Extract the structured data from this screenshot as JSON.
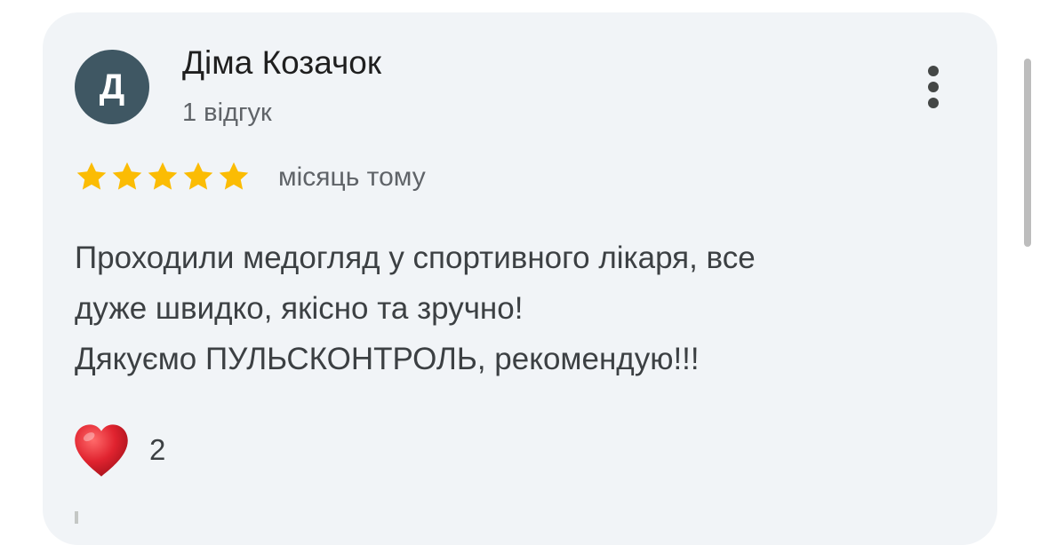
{
  "review": {
    "avatar_letter": "Д",
    "author_name": "Діма Козачок",
    "review_count": "1 відгук",
    "rating": 5,
    "rating_max": 5,
    "time_ago": "місяць тому",
    "text_lines": [
      "Проходили медогляд у спортивного лікаря, все",
      "дуже швидко, якісно та зручно!",
      "Дякуємо ПУЛЬСКОНТРОЛЬ, рекомендую!!!"
    ],
    "reaction_icon": "red-heart-icon",
    "reaction_count": "2"
  },
  "colors": {
    "card_background": "#f1f4f7",
    "avatar_background": "#3f5763",
    "star": "#fbbc04",
    "heart": "#e0232f"
  }
}
